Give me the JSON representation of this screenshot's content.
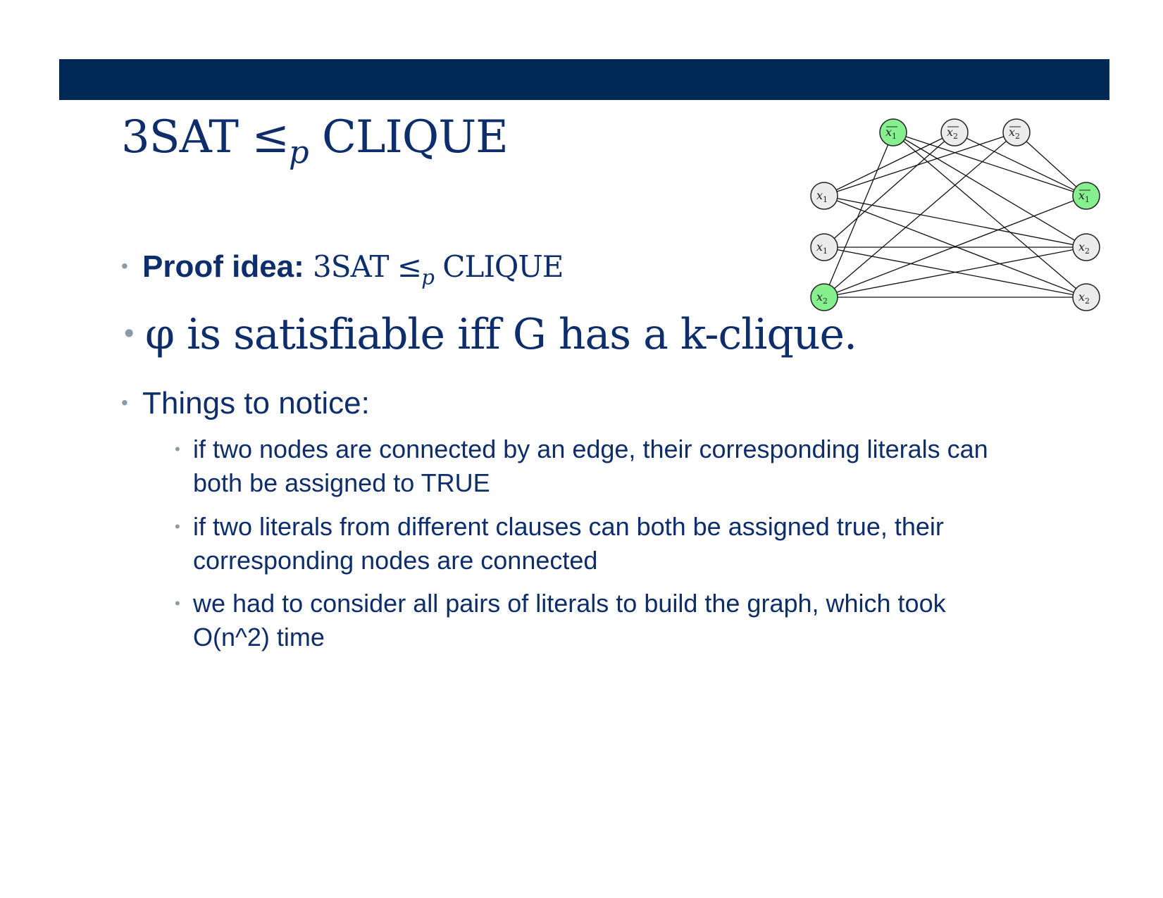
{
  "header": {
    "bar_color": "#002855"
  },
  "title": {
    "prefix": "3SAT ≤",
    "sub": "p",
    "suffix": " CLIQUE"
  },
  "bullets": {
    "proof": {
      "label": "Proof idea:",
      "prefix": "3SAT ≤",
      "sub": "p",
      "suffix": " CLIQUE"
    },
    "statement": "φ is satisfiable iff G has a k-clique.",
    "notice": "Things to notice:",
    "subitems": [
      "if two nodes are connected by an edge, their corresponding literals can both be assigned to TRUE",
      "if two literals from different clauses can both be assigned true, their corresponding nodes are connected",
      "we had to consider all pairs of literals to build the graph, which took O(n^2) time"
    ]
  },
  "graph": {
    "highlight_color": "#86f08f",
    "node_color": "#ececec",
    "nodes": [
      {
        "id": "t1",
        "var": "x",
        "idx": "1",
        "neg": true,
        "highlight": true
      },
      {
        "id": "t2",
        "var": "x",
        "idx": "2",
        "neg": true,
        "highlight": false
      },
      {
        "id": "t3",
        "var": "x",
        "idx": "2",
        "neg": true,
        "highlight": false
      },
      {
        "id": "l1",
        "var": "x",
        "idx": "1",
        "neg": false,
        "highlight": false
      },
      {
        "id": "l2",
        "var": "x",
        "idx": "1",
        "neg": false,
        "highlight": false
      },
      {
        "id": "l3",
        "var": "x",
        "idx": "2",
        "neg": false,
        "highlight": true
      },
      {
        "id": "r1",
        "var": "x",
        "idx": "1",
        "neg": true,
        "highlight": true
      },
      {
        "id": "r2",
        "var": "x",
        "idx": "2",
        "neg": false,
        "highlight": false
      },
      {
        "id": "r3",
        "var": "x",
        "idx": "2",
        "neg": false,
        "highlight": false
      }
    ],
    "edges": [
      [
        "t1",
        "l3"
      ],
      [
        "t1",
        "r1"
      ],
      [
        "t1",
        "r2"
      ],
      [
        "t1",
        "r3"
      ],
      [
        "t2",
        "l1"
      ],
      [
        "t2",
        "l2"
      ],
      [
        "t2",
        "r1"
      ],
      [
        "t3",
        "l1"
      ],
      [
        "t3",
        "l3"
      ],
      [
        "t3",
        "r1"
      ],
      [
        "l1",
        "r2"
      ],
      [
        "l1",
        "r3"
      ],
      [
        "l2",
        "r2"
      ],
      [
        "l2",
        "r3"
      ],
      [
        "l3",
        "r1"
      ],
      [
        "l3",
        "r2"
      ],
      [
        "l3",
        "r3"
      ]
    ]
  }
}
